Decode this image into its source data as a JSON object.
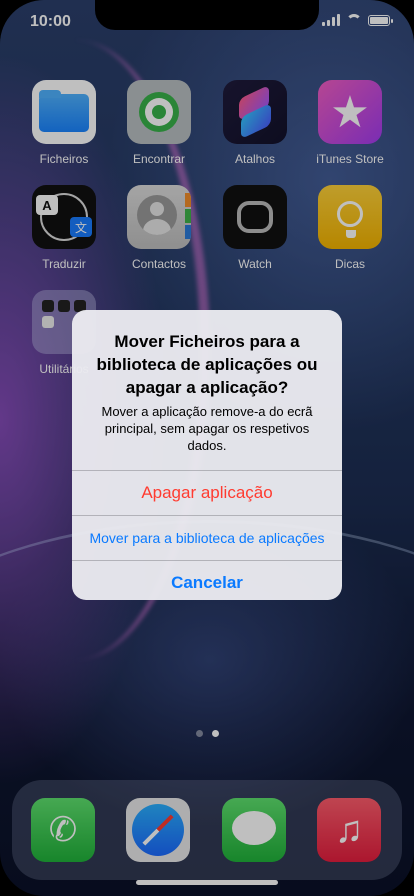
{
  "status": {
    "time": "10:00"
  },
  "apps_row1": [
    {
      "label": "Ficheiros"
    },
    {
      "label": "Encontrar"
    },
    {
      "label": "Atalhos"
    },
    {
      "label": "iTunes Store"
    }
  ],
  "apps_row2": [
    {
      "label": "Traduzir"
    },
    {
      "label": "Contactos"
    },
    {
      "label": "Watch"
    },
    {
      "label": "Dicas"
    }
  ],
  "folder": {
    "label": "Utilitários"
  },
  "dock": [
    "phone-icon",
    "safari-icon",
    "messages-icon",
    "music-icon"
  ],
  "alert": {
    "title": "Mover Ficheiros para a biblioteca de aplicações ou apagar a aplicação?",
    "message": "Mover a aplicação remove-a do ecrã principal, sem apagar os respetivos dados.",
    "delete_label": "Apagar aplicação",
    "move_label": "Mover para a biblioteca de aplicações",
    "cancel_label": "Cancelar"
  },
  "colors": {
    "destructive": "#ff3b30",
    "accent": "#0a7aff"
  }
}
